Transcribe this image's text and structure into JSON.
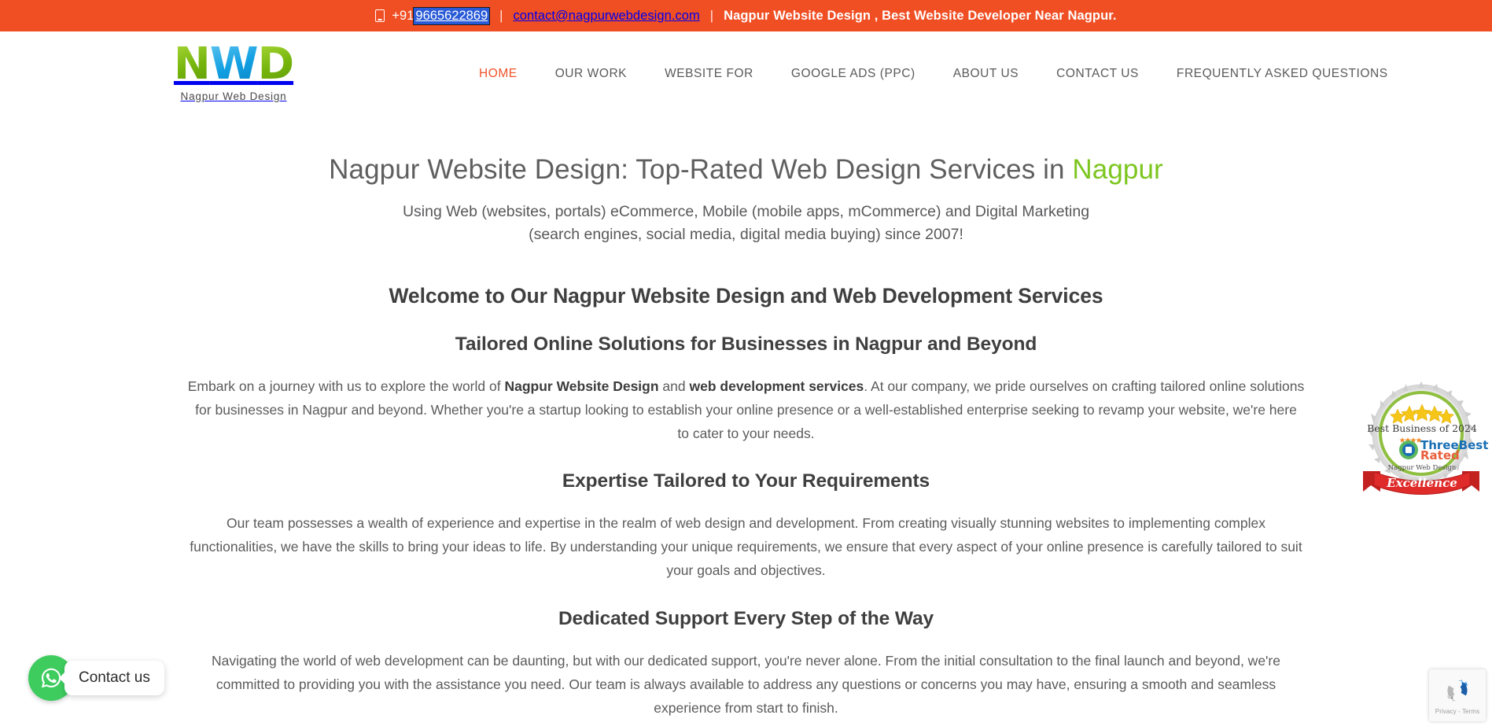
{
  "topbar": {
    "phone_icon": "phone-icon",
    "phone_prefix": "+91 ",
    "phone_number": "9665622869",
    "sep1": "|",
    "email": "contact@nagpurwebdesign.com",
    "sep2": "|",
    "tagline": "Nagpur Website Design , Best Website Developer Near Nagpur.",
    "bg_color": "#f04e23",
    "selection_color": "#2a5bd7"
  },
  "header": {
    "logo": {
      "letter_1": "N",
      "letter_2": "W",
      "letter_3": "D",
      "tagline": "Nagpur Web Design",
      "green": "#7dbb1e",
      "blue": "#22a3e0"
    },
    "nav": [
      {
        "label": "HOME",
        "active": true
      },
      {
        "label": "OUR WORK",
        "active": false
      },
      {
        "label": "WEBSITE FOR",
        "active": false
      },
      {
        "label": "GOOGLE ADS (PPC)",
        "active": false
      },
      {
        "label": "ABOUT US",
        "active": false
      },
      {
        "label": "CONTACT US",
        "active": false
      },
      {
        "label": "FREQUENTLY ASKED QUESTIONS",
        "active": false
      }
    ],
    "active_color": "#f0542a"
  },
  "main": {
    "h1_part1": "Nagpur Website Design: Top-Rated Web Design Services in ",
    "h1_highlight": "Nagpur",
    "h1_highlight_color": "#7cc61f",
    "subhead": "Using Web (websites, portals) eCommerce, Mobile (mobile apps, mCommerce) and Digital Marketing (search engines, social media, digital media buying) since 2007!",
    "section_welcome_title": "Welcome to Our Nagpur Website Design and Web Development Services",
    "section_tailored_title": "Tailored Online Solutions for Businesses in Nagpur and Beyond",
    "paragraph_1_a": "Embark on a journey with us to explore the world of ",
    "paragraph_1_b1": "Nagpur Website Design",
    "paragraph_1_c": " and ",
    "paragraph_1_b2": "web development services",
    "paragraph_1_d": ". At our company, we pride ourselves on crafting tailored online solutions for businesses in Nagpur and beyond. Whether you're a startup looking to establish your online presence or a well-established enterprise seeking to revamp your website, we're here to cater to your needs.",
    "section_expertise_title": "Expertise Tailored to Your Requirements",
    "paragraph_2": "Our team possesses a wealth of experience and expertise in the realm of web design and development. From creating visually stunning websites to implementing complex functionalities, we have the skills to bring your ideas to life. By understanding your unique requirements, we ensure that every aspect of your online presence is carefully tailored to suit your goals and objectives.",
    "section_support_title": "Dedicated Support Every Step of the Way",
    "paragraph_3": "Navigating the world of web development can be daunting, but with our dedicated support, you're never alone. From the initial consultation to the final launch and beyond, we're committed to providing you with the assistance you need. Our team is always available to address any questions or concerns you may have, ensuring a smooth and seamless experience from start to finish."
  },
  "badge": {
    "icon": "award-badge-icon",
    "line_top": "Best Business of 2024",
    "brand_1": "ThreeBest",
    "brand_2": "Rated",
    "business_name": "Nagpur Web Design",
    "ribbon": "Excellence",
    "star_color": "#f5c518",
    "ring_color": "#8fbf3f"
  },
  "whatsapp": {
    "icon": "whatsapp-icon",
    "label": "Contact us",
    "color": "#3ecc5f"
  },
  "recaptcha": {
    "icon": "recaptcha-icon",
    "label": "Privacy - Terms"
  }
}
